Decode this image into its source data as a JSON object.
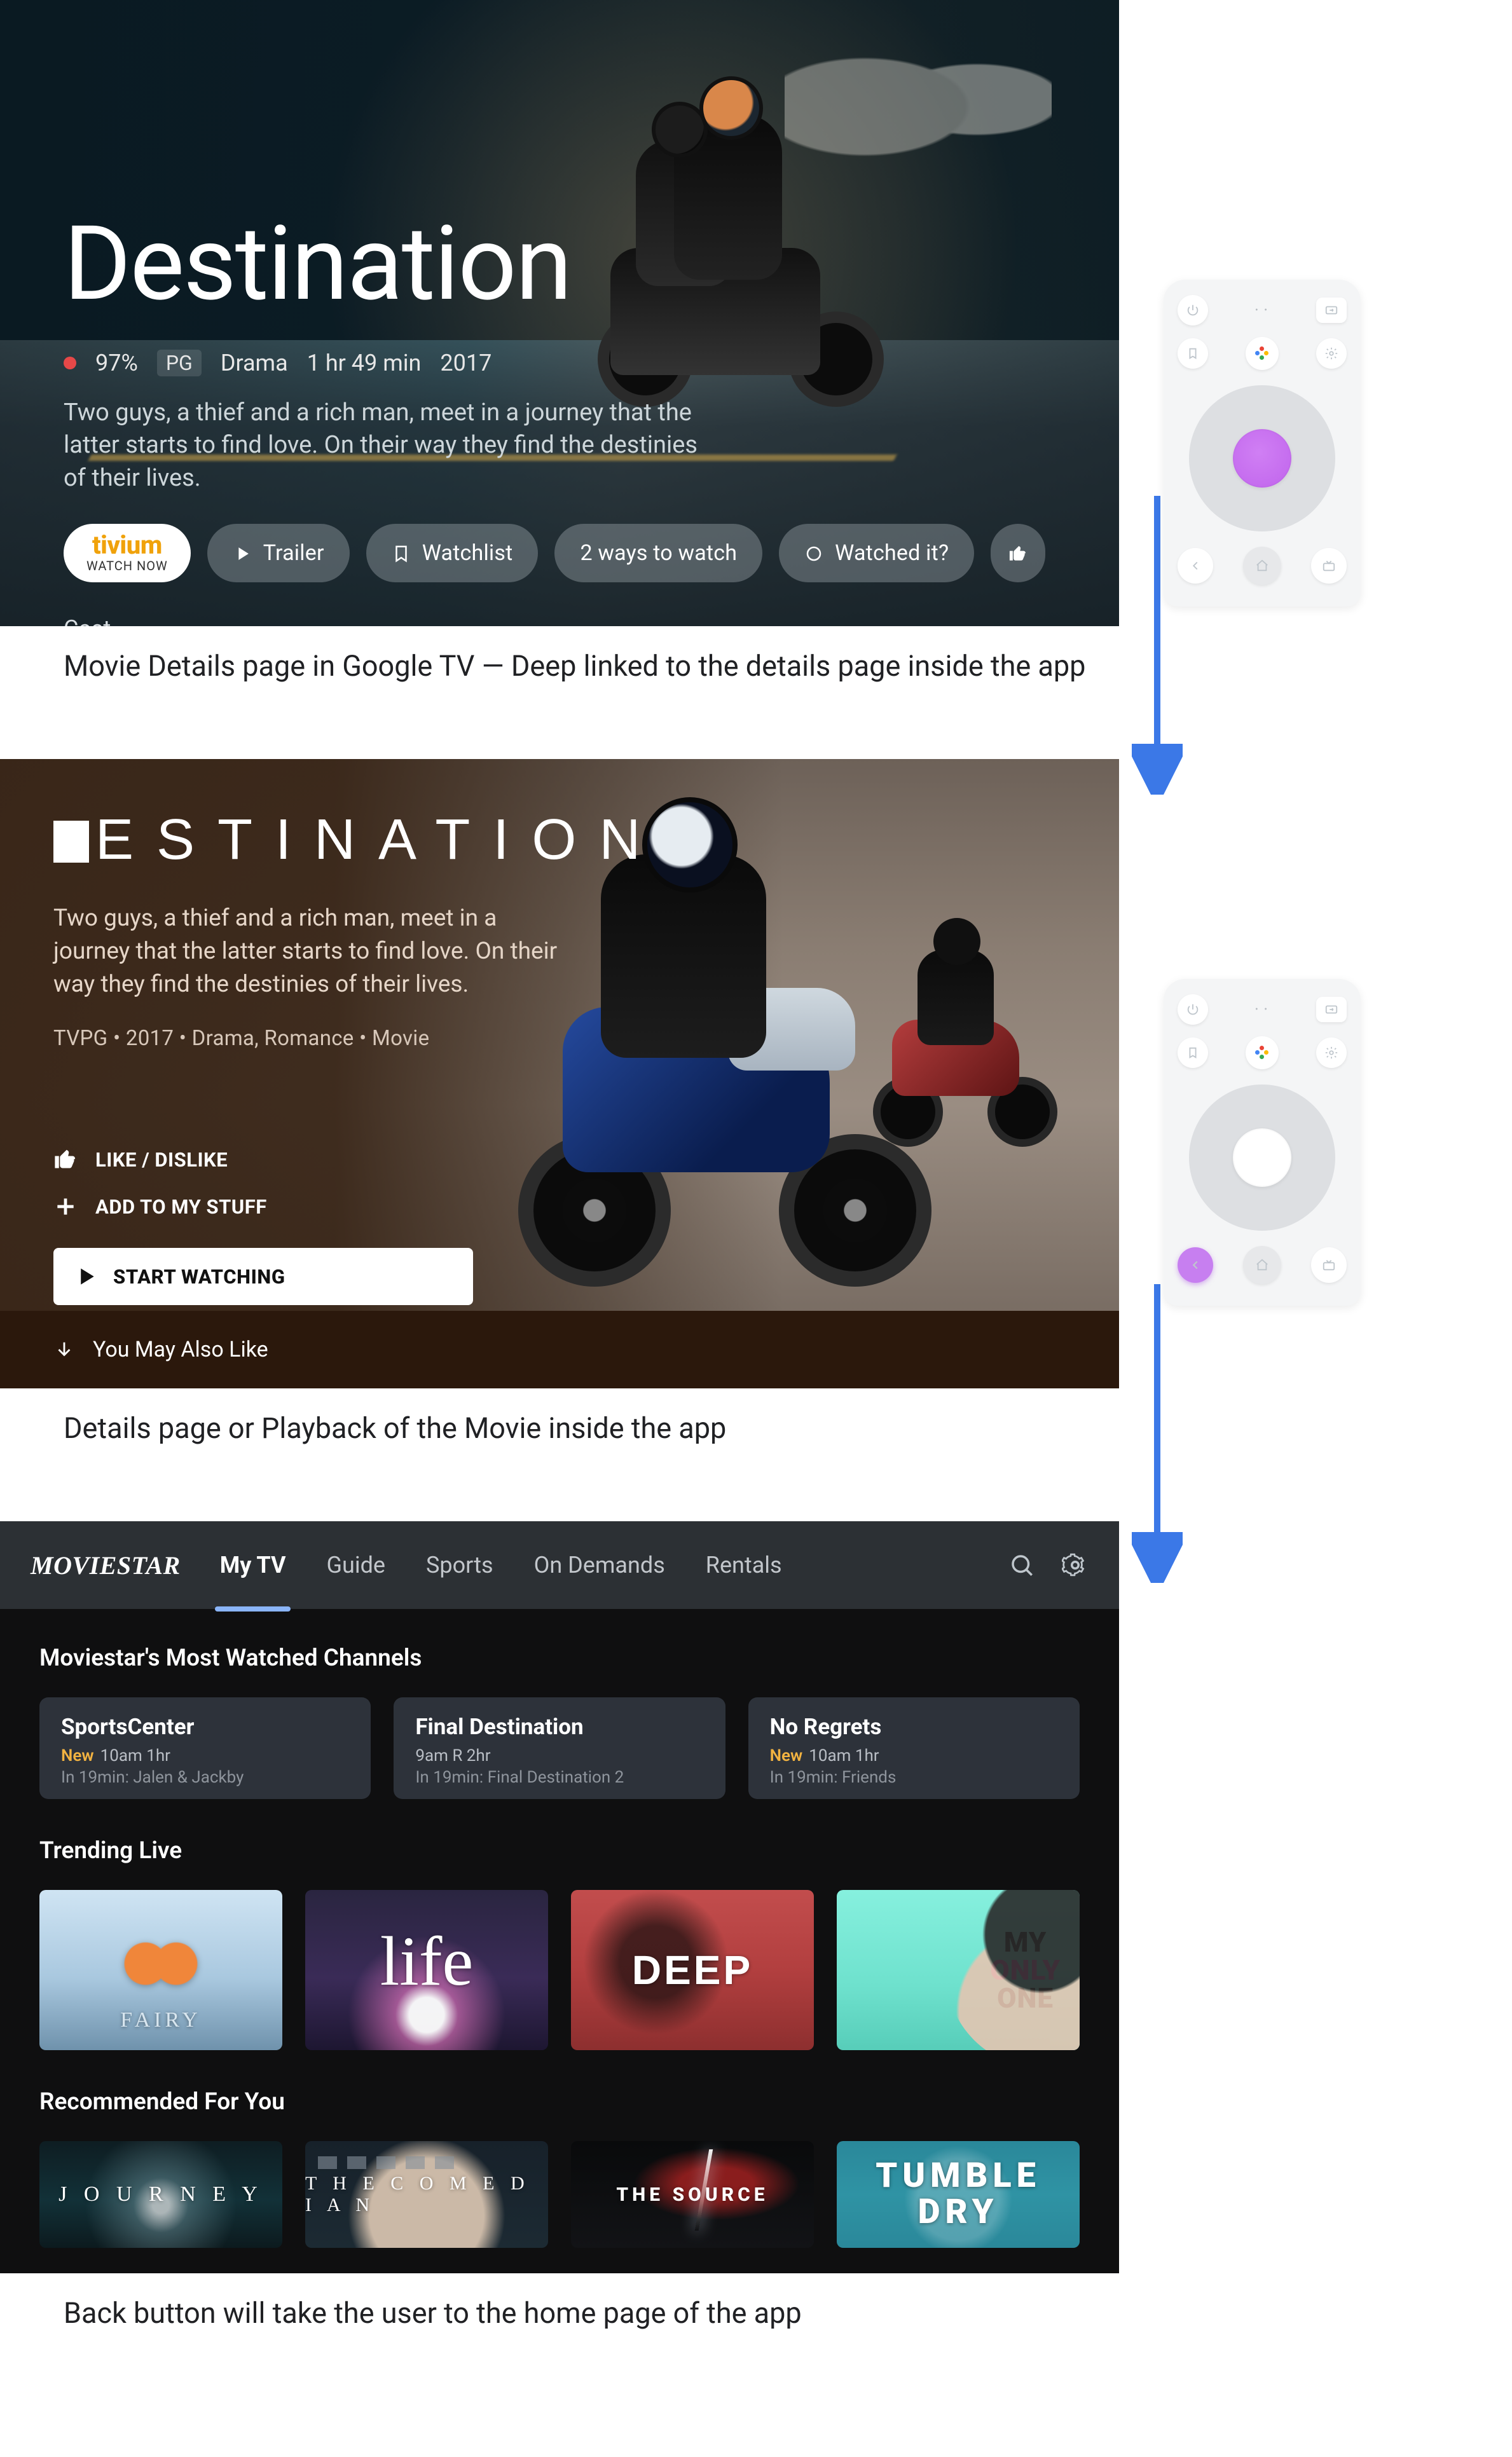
{
  "captions": {
    "c1": "Movie Details page in Google TV — Deep linked to the details page inside the app",
    "c2": "Details page or Playback of the Movie inside the app",
    "c3": "Back button will take the user to the home page of the app"
  },
  "gtv": {
    "title": "Destination",
    "rating_pct": "97%",
    "content_rating": "PG",
    "genre": "Drama",
    "runtime": "1 hr 49 min",
    "year": "2017",
    "description": "Two guys, a thief and a rich man, meet in a journey that the latter starts to find love. On their way they find the destinies of their lives.",
    "primary_brand": "tivium",
    "primary_sub": "WATCH NOW",
    "btn_trailer": "Trailer",
    "btn_watchlist": "Watchlist",
    "btn_ways": "2 ways to watch",
    "btn_watched": "Watched it?",
    "cast_label": "Cast"
  },
  "app": {
    "title": "ESTINATION",
    "description": "Two guys, a thief and a rich man, meet in a journey that the latter starts to find love. On their way they find the destinies of their lives.",
    "meta": "TVPG • 2017 • Drama, Romance • Movie",
    "like": "LIKE / DISLIKE",
    "add": "ADD TO MY STUFF",
    "start": "START WATCHING",
    "footer": "You May Also Like"
  },
  "ms": {
    "brand": "MOVIESTAR",
    "tabs": [
      "My TV",
      "Guide",
      "Sports",
      "On Demands",
      "Rentals"
    ],
    "active_tab_index": 0,
    "section_channels": "Moviestar's Most Watched Channels",
    "cards": [
      {
        "title": "SportsCenter",
        "new": true,
        "time": "10am 1hr",
        "next": "In 19min: Jalen & Jackby"
      },
      {
        "title": "Final Destination",
        "new": false,
        "time": "9am R 2hr",
        "next": "In 19min: Final Destination 2"
      },
      {
        "title": "No Regrets",
        "new": true,
        "time": "10am 1hr",
        "next": "In 19min: Friends"
      }
    ],
    "new_label": "New",
    "section_trending": "Trending Live",
    "trending": [
      {
        "key": "fairy",
        "label": "FAIRY"
      },
      {
        "key": "life",
        "label": "life"
      },
      {
        "key": "deep",
        "label": "DEEP"
      },
      {
        "key": "one",
        "label_top": "MY",
        "label_mid": "ONLY",
        "label_bot": "ONE"
      }
    ],
    "section_rec": "Recommended For You",
    "recommended": [
      {
        "key": "journey",
        "label": "J O U R N E Y"
      },
      {
        "key": "comedian",
        "label": "T H E   C O M E D I A N"
      },
      {
        "key": "source",
        "label": "THE SOURCE"
      },
      {
        "key": "tumble",
        "label_top": "TUMBLE",
        "label_bot": "DRY"
      }
    ]
  },
  "remote": {
    "icons": {
      "power": "power-icon",
      "input": "input-icon",
      "bookmark": "bookmark-icon",
      "assistant": "assistant-icon",
      "settings": "settings-gear-icon",
      "back": "back-arrow-icon",
      "home": "home-icon",
      "tv": "live-tv-icon"
    }
  }
}
